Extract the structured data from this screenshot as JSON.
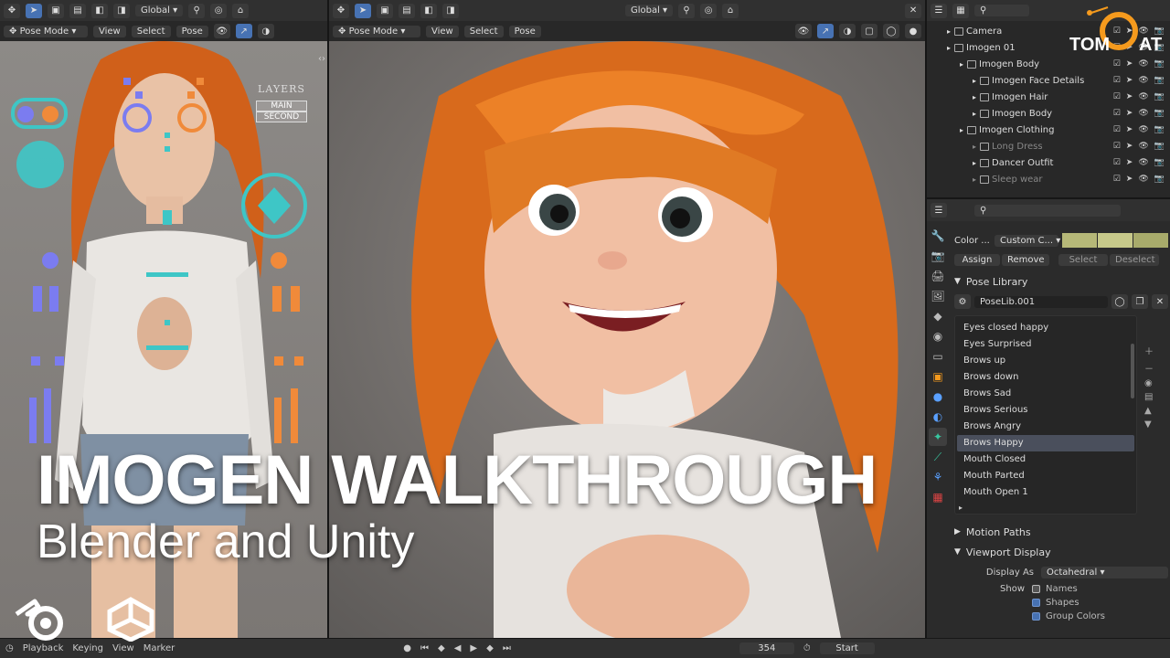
{
  "left_viewport": {
    "orientation": "Global",
    "mode": "Pose Mode",
    "menus": [
      "View",
      "Select",
      "Pose"
    ],
    "layers_panel": {
      "title": "LAYERS",
      "main": "MAIN",
      "second": "SECOND"
    }
  },
  "center_viewport": {
    "orientation": "Global",
    "mode": "Pose Mode",
    "menus": [
      "View",
      "Select",
      "Pose"
    ]
  },
  "overlay_title": {
    "line1": "IMOGEN WALKTHROUGH",
    "line2": "Blender and Unity"
  },
  "logo": {
    "text_left": "TOM",
    "text_right": "AT"
  },
  "outliner": {
    "rows": [
      {
        "label": "Camera",
        "indent": 1
      },
      {
        "label": "Imogen 01",
        "indent": 1
      },
      {
        "label": "Imogen Body",
        "indent": 2
      },
      {
        "label": "Imogen Face Details",
        "indent": 3
      },
      {
        "label": "Imogen Hair",
        "indent": 3
      },
      {
        "label": "Imogen Body",
        "indent": 3
      },
      {
        "label": "Imogen Clothing",
        "indent": 2
      },
      {
        "label": "Long Dress",
        "indent": 3,
        "dim": true
      },
      {
        "label": "Dancer Outfit",
        "indent": 3
      },
      {
        "label": "Sleep wear",
        "indent": 3,
        "dim": true
      }
    ]
  },
  "properties": {
    "color_label": "Color ...",
    "color_set": "Custom C...",
    "assign": "Assign",
    "remove": "Remove",
    "select": "Select",
    "deselect": "Deselect",
    "pose_library_title": "Pose Library",
    "poselib_name": "PoseLib.001",
    "poses": [
      "Eyes closed happy",
      "Eyes Surprised",
      "Brows up",
      "Brows down",
      "Brows Sad",
      "Brows Serious",
      "Brows Angry",
      "Brows Happy",
      "Mouth Closed",
      "Mouth Parted",
      "Mouth Open 1"
    ],
    "active_pose": "Brows Happy",
    "motion_paths": "Motion Paths",
    "viewport_display": "Viewport Display",
    "display_as_label": "Display As",
    "display_as_value": "Octahedral",
    "show_label": "Show",
    "show_options": [
      {
        "label": "Names",
        "checked": false
      },
      {
        "label": "Shapes",
        "checked": true
      },
      {
        "label": "Group Colors",
        "checked": true
      }
    ]
  },
  "timeline": {
    "menus": [
      "Playback",
      "Keying",
      "View",
      "Marker"
    ],
    "frame": "354",
    "start_label": "Start"
  },
  "colors": {
    "accent": "#4772b3",
    "hair": "#e06a1a",
    "rig_cyan": "#3ec6c6",
    "rig_blue": "#7b7cf0",
    "rig_orange": "#f08a3a",
    "logo_orange": "#f59a1d"
  }
}
